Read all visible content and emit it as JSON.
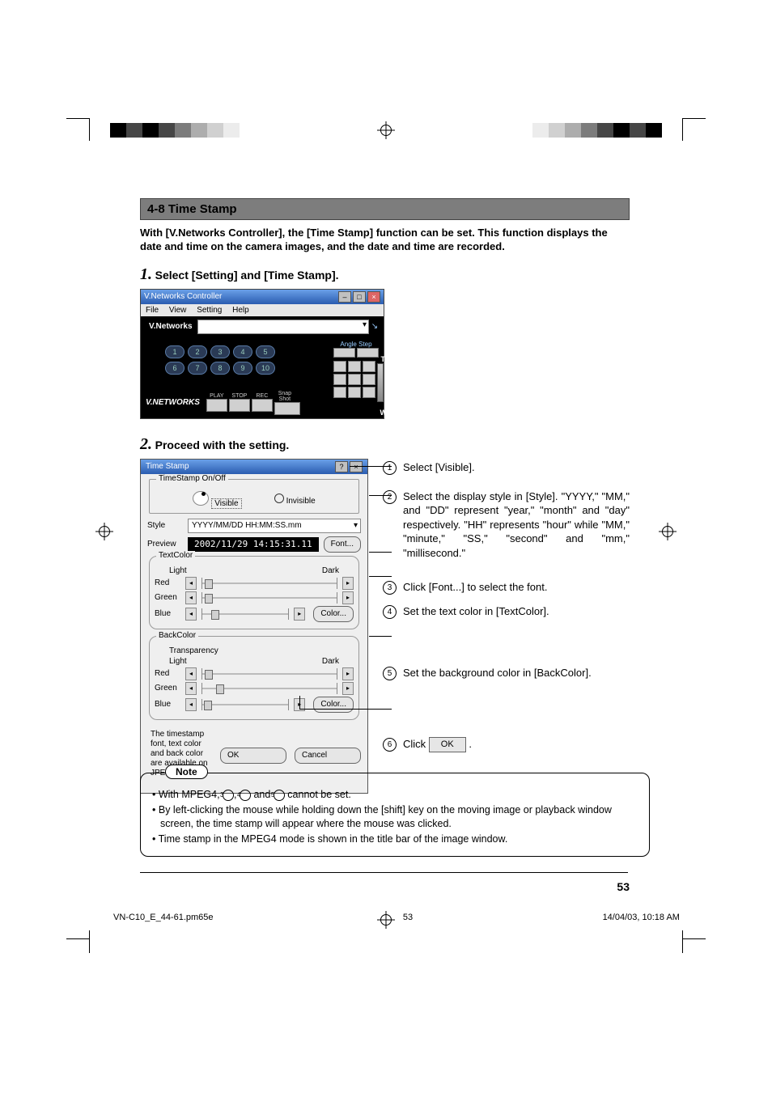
{
  "header": {
    "title": "4-8 Time Stamp"
  },
  "intro": "With [V.Networks Controller], the [Time Stamp] function can be set.  This function displays the date and time on the camera images, and the date and time are recorded.",
  "step1": {
    "num": "1.",
    "text": "Select [Setting] and [Time Stamp]."
  },
  "step2": {
    "num": "2.",
    "text": "Proceed with the setting."
  },
  "controller": {
    "title": "V.Networks Controller",
    "menu": [
      "File",
      "View",
      "Setting",
      "Help"
    ],
    "section_label": "V.Networks",
    "angle_label": "Angle Step",
    "presets": [
      "1",
      "2",
      "3",
      "4",
      "5",
      "6",
      "7",
      "8",
      "9",
      "10"
    ],
    "play_labels": [
      "PLAY",
      "STOP",
      "REC",
      "Snap Shot"
    ],
    "logo": "V.NETWORKS",
    "T": "T",
    "W": "W"
  },
  "dialog": {
    "title": "Time Stamp",
    "onoff_label": "TimeStamp On/Off",
    "radio_visible": "Visible",
    "radio_invisible": "Invisible",
    "style_label": "Style",
    "style_value": "YYYY/MM/DD HH:MM:SS.mm",
    "preview_label": "Preview",
    "preview_value": "2002/11/29 14:15:31.11",
    "font_btn": "Font...",
    "textcolor_label": "TextColor",
    "backcolor_label": "BackColor",
    "transparency_label": "Transparency",
    "light": "Light",
    "dark": "Dark",
    "red": "Red",
    "green": "Green",
    "blue": "Blue",
    "color_btn": "Color...",
    "footnote": "The timestamp font, text color and back color are available on JPEG Mode.",
    "ok": "OK",
    "cancel": "Cancel"
  },
  "annots": {
    "a1": "Select [Visible].",
    "a2": "Select the display style in [Style]. \"YYYY,\" \"MM,\" and \"DD\" represent \"year,\" \"month\" and \"day\" respectively. \"HH\" represents \"hour\" while \"MM,\" \"minute,\" \"SS,\" \"second\" and \"mm,\" \"millisecond.\"",
    "a3": "Click [Font...] to select the font.",
    "a4": "Set the text color in [TextColor].",
    "a5": "Set the background color in [BackColor].",
    "a6_pre": "Click",
    "a6_ok": "OK",
    "a6_post": "."
  },
  "note": {
    "label": "Note",
    "li1_pre": "With MPEG4, ",
    "li1_mid": " and ",
    "li1_post": " cannot be set.",
    "li2": "By left-clicking the mouse while holding down the [shift] key on the moving image or playback window screen, the time stamp will appear where the mouse was clicked.",
    "li3": "Time stamp in the MPEG4 mode is shown in the title bar of the image window."
  },
  "page_num": "53",
  "footer": {
    "file": "VN-C10_E_44-61.pm65e",
    "pg": "53",
    "date": "14/04/03, 10:18 AM"
  }
}
